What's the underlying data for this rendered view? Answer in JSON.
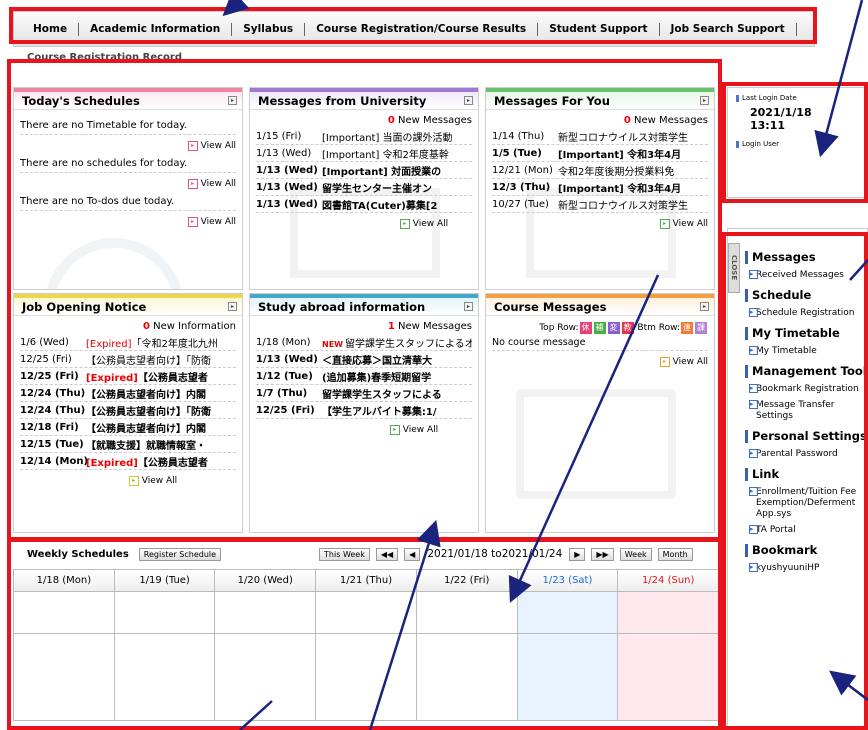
{
  "nav": {
    "items": [
      "Home",
      "Academic Information",
      "Syllabus",
      "Course Registration/Course Results",
      "Student Support",
      "Job Search Support"
    ]
  },
  "breadcrumb": "Course Registration Record",
  "todays_schedules": {
    "title": "Today's Schedules",
    "timetable_msg": "There are no Timetable for today.",
    "schedules_msg": "There are no schedules for today.",
    "todos_msg": "There are no To-dos due today.",
    "view_all": "View All"
  },
  "messages_university": {
    "title": "Messages from University",
    "count": "0",
    "count_label": "New Messages",
    "rows": [
      {
        "date": "1/15 (Fri)",
        "text": "[Important] 当面の課外活動",
        "bold": false
      },
      {
        "date": "1/13 (Wed)",
        "text": "[Important] 令和2年度基幹",
        "bold": false
      },
      {
        "date": "1/13 (Wed)",
        "text": "[Important] 対面授業の",
        "bold": true
      },
      {
        "date": "1/13 (Wed)",
        "text": "留学生センター主催オン",
        "bold": true
      },
      {
        "date": "1/13 (Wed)",
        "text": "図書館TA(Cuter)募集[2",
        "bold": true
      }
    ],
    "view_all": "View All"
  },
  "messages_you": {
    "title": "Messages For You",
    "count": "0",
    "count_label": "New Messages",
    "rows": [
      {
        "date": "1/14 (Thu)",
        "text": "新型コロナウイルス対策学生",
        "bold": false
      },
      {
        "date": "1/5 (Tue)",
        "text": "[Important] 令和3年4月",
        "bold": true
      },
      {
        "date": "12/21 (Mon)",
        "text": "令和2年度後期分授業料免",
        "bold": false
      },
      {
        "date": "12/3 (Thu)",
        "text": "[Important] 令和3年4月",
        "bold": true
      },
      {
        "date": "10/27 (Tue)",
        "text": "新型コロナウイルス対策学生",
        "bold": false
      }
    ],
    "view_all": "View All"
  },
  "job_opening": {
    "title": "Job Opening Notice",
    "count": "0",
    "count_label": "New Information",
    "rows": [
      {
        "date": "1/6 (Wed)",
        "expired": "[Expired]",
        "text": "「令和2年度北九州",
        "bold": false
      },
      {
        "date": "12/25 (Fri)",
        "expired": "",
        "text": "【公務員志望者向け】「防衛",
        "bold": false
      },
      {
        "date": "12/25 (Fri)",
        "expired": "[Expired]",
        "text": "【公務員志望者",
        "bold": true
      },
      {
        "date": "12/24 (Thu)",
        "expired": "",
        "text": "【公務員志望者向け】内閣",
        "bold": true
      },
      {
        "date": "12/24 (Thu)",
        "expired": "",
        "text": "【公務員志望者向け】「防衛",
        "bold": true
      },
      {
        "date": "12/18 (Fri)",
        "expired": "",
        "text": "【公務員志望者向け】内閣",
        "bold": true
      },
      {
        "date": "12/15 (Tue)",
        "expired": "",
        "text": "【就職支援】就職情報室・",
        "bold": true
      },
      {
        "date": "12/14 (Mon)",
        "expired": "[Expired]",
        "text": "【公務員志望者",
        "bold": true
      }
    ],
    "view_all": "View All"
  },
  "study_abroad": {
    "title": "Study abroad information",
    "count": "1",
    "count_label": "New Messages",
    "rows": [
      {
        "date": "1/18 (Mon)",
        "new": "NEW",
        "text": "留学課学生スタッフによるオ",
        "bold": false
      },
      {
        "date": "1/13 (Wed)",
        "new": "",
        "text": "＜直接応募＞国立清華大",
        "bold": true
      },
      {
        "date": "1/12 (Tue)",
        "new": "",
        "text": "(追加募集)春季短期留学",
        "bold": true
      },
      {
        "date": "1/7 (Thu)",
        "new": "",
        "text": "留学課学生スタッフによる",
        "bold": true
      },
      {
        "date": "12/25 (Fri)",
        "new": "",
        "text": "【学生アルバイト募集:1/",
        "bold": true
      }
    ],
    "view_all": "View All"
  },
  "course_messages": {
    "title": "Course Messages",
    "top_row": "Top Row:",
    "btm_row": "Btm Row:",
    "tags_top": [
      "休",
      "補",
      "変",
      "教"
    ],
    "tags_btm": [
      "連",
      "課"
    ],
    "tag_colors_top": [
      "#e8407a",
      "#49b049",
      "#8a5fd0",
      "#e83050"
    ],
    "tag_colors_btm": [
      "#f07a30",
      "#b080d8"
    ],
    "no_msg": "No course message",
    "view_all": "View All"
  },
  "weekly": {
    "title": "Weekly Schedules",
    "register_btn": "Register Schedule",
    "this_week": "This Week",
    "range": "2021/01/18 to2021/01/24",
    "week_btn": "Week",
    "month_btn": "Month",
    "days": [
      "1/18 (Mon)",
      "1/19 (Tue)",
      "1/20 (Wed)",
      "1/21 (Thu)",
      "1/22 (Fri)",
      "1/23 (Sat)",
      "1/24 (Sun)"
    ]
  },
  "login": {
    "last_login_label": "Last Login Date",
    "date": "2021/1/18",
    "time": "13:11",
    "user_label": "Login User"
  },
  "sidebar": {
    "close": "CLOSE",
    "sections": [
      {
        "title": "Messages",
        "items": [
          "Received Messages"
        ]
      },
      {
        "title": "Schedule",
        "items": [
          "Schedule Registration"
        ]
      },
      {
        "title": "My Timetable",
        "items": [
          "My Timetable"
        ]
      },
      {
        "title": "Management Tool",
        "items": [
          "Bookmark Registration",
          "Message Transfer Settings"
        ]
      },
      {
        "title": "Personal Settings",
        "items": [
          "Parental Password"
        ]
      },
      {
        "title": "Link",
        "items": [
          "Enrollment/Tuition Fee Exemption/Deferment App.sys",
          "TA Portal"
        ]
      },
      {
        "title": "Bookmark",
        "items": [
          "kyushyuuniHP"
        ]
      }
    ]
  }
}
